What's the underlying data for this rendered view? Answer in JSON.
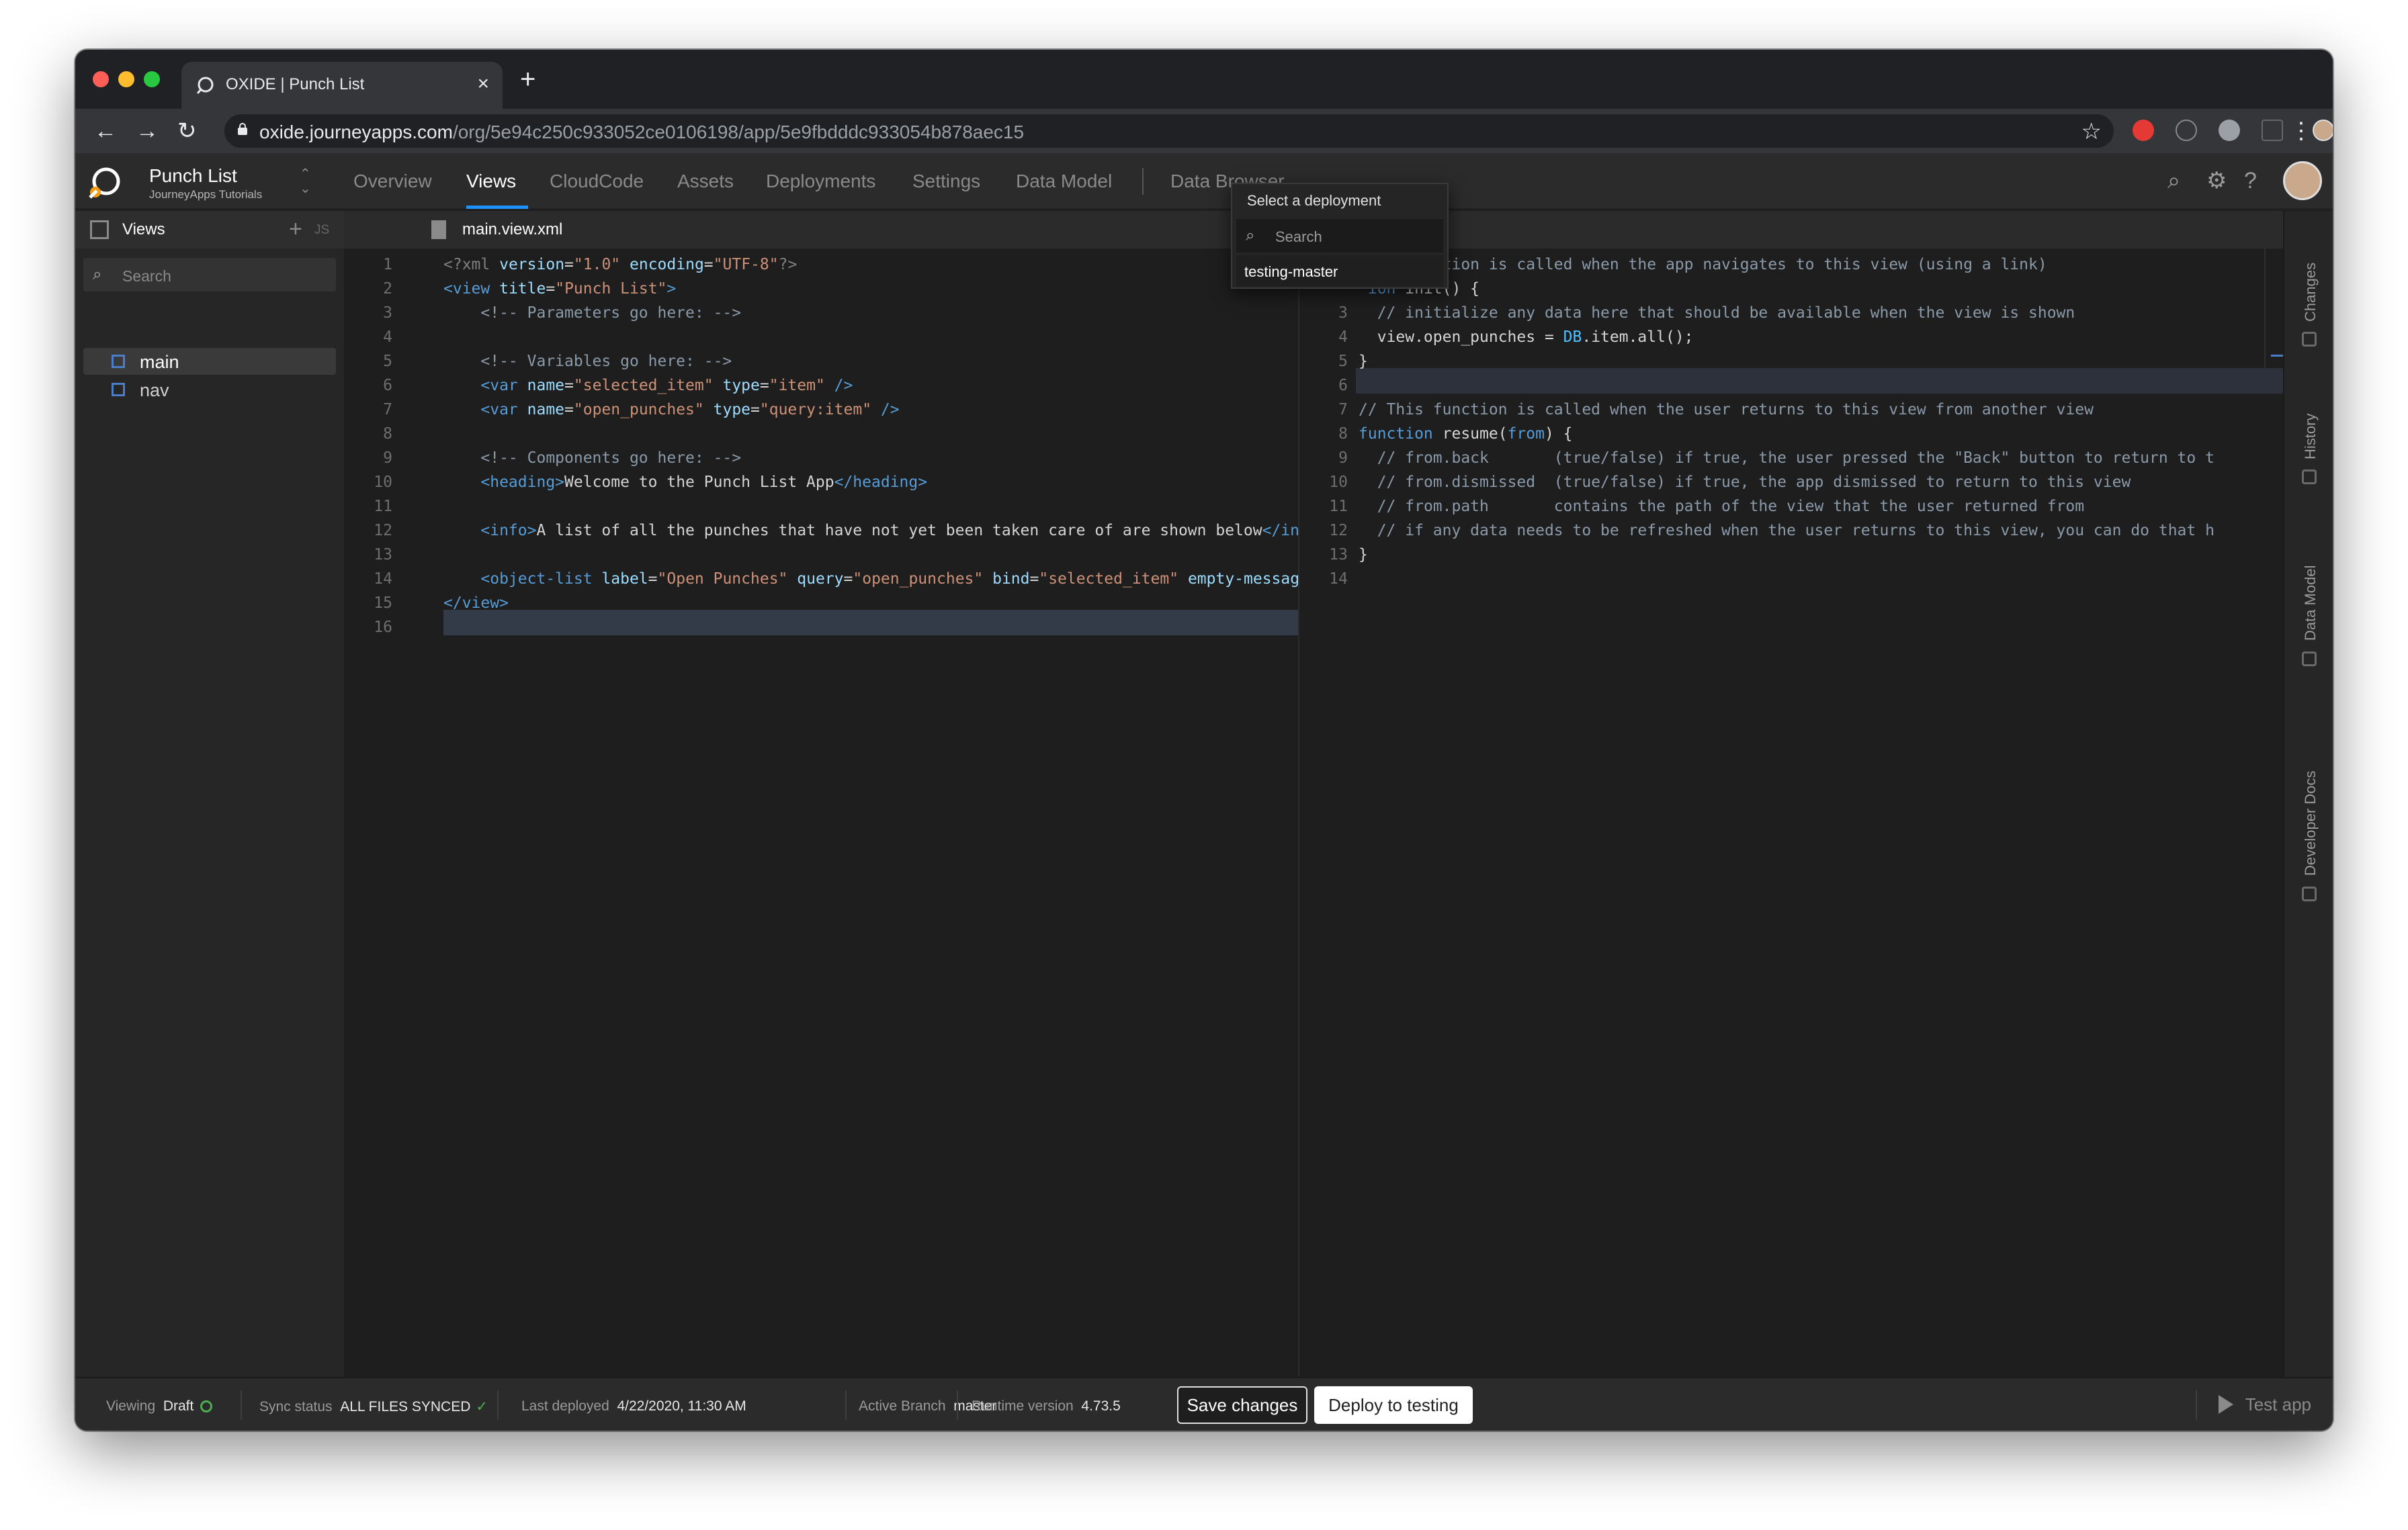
{
  "browser": {
    "tab_title": "OXIDE | Punch List",
    "tab_close": "×",
    "new_tab": "+",
    "url_host": "oxide.journeyapps.com",
    "url_path": "/org/5e94c250c933052ce0106198/app/5e9fbdddc933054b878aec15",
    "back": "←",
    "forward": "→",
    "reload": "↻",
    "bookmark": "☆",
    "menu": "⋮"
  },
  "app": {
    "project_name": "Punch List",
    "project_org": "JourneyApps Tutorials",
    "nav_tabs": [
      {
        "label": "Overview"
      },
      {
        "label": "Views"
      },
      {
        "label": "CloudCode"
      },
      {
        "label": "Assets"
      },
      {
        "label": "Deployments"
      },
      {
        "label": "Settings"
      },
      {
        "label": "Data Model"
      },
      {
        "label": "Data Browser"
      }
    ],
    "active_tab": "Views",
    "accent_color": "#1e90ff"
  },
  "dropdown": {
    "title": "Select a deployment",
    "search_placeholder": "Search",
    "items": [
      "testing-master"
    ]
  },
  "sidebar": {
    "title": "Views",
    "add": "+",
    "js_label": "JS",
    "search_placeholder": "Search",
    "items": [
      {
        "label": "main",
        "selected": true
      },
      {
        "label": "nav",
        "selected": false
      }
    ]
  },
  "editor": {
    "file_name": "main.view.xml",
    "xml_lines": [
      {
        "n": "1",
        "t": "<?xml version=\"1.0\" encoding=\"UTF-8\"?>"
      },
      {
        "n": "2",
        "t": "<view title=\"Punch List\">"
      },
      {
        "n": "3",
        "t": "    <!-- Parameters go here: -->"
      },
      {
        "n": "4",
        "t": ""
      },
      {
        "n": "5",
        "t": "    <!-- Variables go here: -->"
      },
      {
        "n": "6",
        "t": "    <var name=\"selected_item\" type=\"item\" />"
      },
      {
        "n": "7",
        "t": "    <var name=\"open_punches\" type=\"query:item\" />"
      },
      {
        "n": "8",
        "t": ""
      },
      {
        "n": "9",
        "t": "    <!-- Components go here: -->"
      },
      {
        "n": "10",
        "t": "    <heading>Welcome to the Punch List App</heading>"
      },
      {
        "n": "11",
        "t": ""
      },
      {
        "n": "12",
        "t": "    <info>A list of all the punches that have not yet been taken care of are shown below</in"
      },
      {
        "n": "13",
        "t": ""
      },
      {
        "n": "14",
        "t": "    <object-list label=\"Open Punches\" query=\"open_punches\" bind=\"selected_item\" empty-messag"
      },
      {
        "n": "15",
        "t": "</view>"
      },
      {
        "n": "16",
        "t": ""
      }
    ],
    "js_lines": [
      {
        "n": "",
        "t": "  is function is called when the app navigates to this view (using a link)"
      },
      {
        "n": "",
        "t": " ion init() {"
      },
      {
        "n": "3",
        "t": "  // initialize any data here that should be available when the view is shown"
      },
      {
        "n": "4",
        "t": "  view.open_punches = DB.item.all();"
      },
      {
        "n": "5",
        "t": "}"
      },
      {
        "n": "6",
        "t": ""
      },
      {
        "n": "7",
        "t": "// This function is called when the user returns to this view from another view"
      },
      {
        "n": "8",
        "t": "function resume(from) {"
      },
      {
        "n": "9",
        "t": "  // from.back       (true/false) if true, the user pressed the \"Back\" button to return to t"
      },
      {
        "n": "10",
        "t": "  // from.dismissed  (true/false) if true, the app dismissed to return to this view"
      },
      {
        "n": "11",
        "t": "  // from.path       contains the path of the view that the user returned from"
      },
      {
        "n": "12",
        "t": "  // if any data needs to be refreshed when the user returns to this view, you can do that h"
      },
      {
        "n": "13",
        "t": "}"
      },
      {
        "n": "14",
        "t": ""
      }
    ]
  },
  "rail": {
    "items": [
      {
        "label": "Changes",
        "icon": "changes-icon"
      },
      {
        "label": "History",
        "icon": "history-icon"
      },
      {
        "label": "Data Model",
        "icon": "data-model-icon"
      },
      {
        "label": "Developer Docs",
        "icon": "docs-icon"
      }
    ]
  },
  "status": {
    "viewing_label": "Viewing",
    "viewing_value": "Draft",
    "sync_label": "Sync status",
    "sync_value": "ALL FILES SYNCED",
    "deployed_label": "Last deployed",
    "deployed_value": "4/22/2020, 11:30 AM",
    "branch_label": "Active Branch",
    "branch_value": "master",
    "runtime_label": "Runtime version",
    "runtime_value": "4.73.5",
    "save_button": "Save changes",
    "deploy_button": "Deploy to testing",
    "test_app": "Test app"
  }
}
